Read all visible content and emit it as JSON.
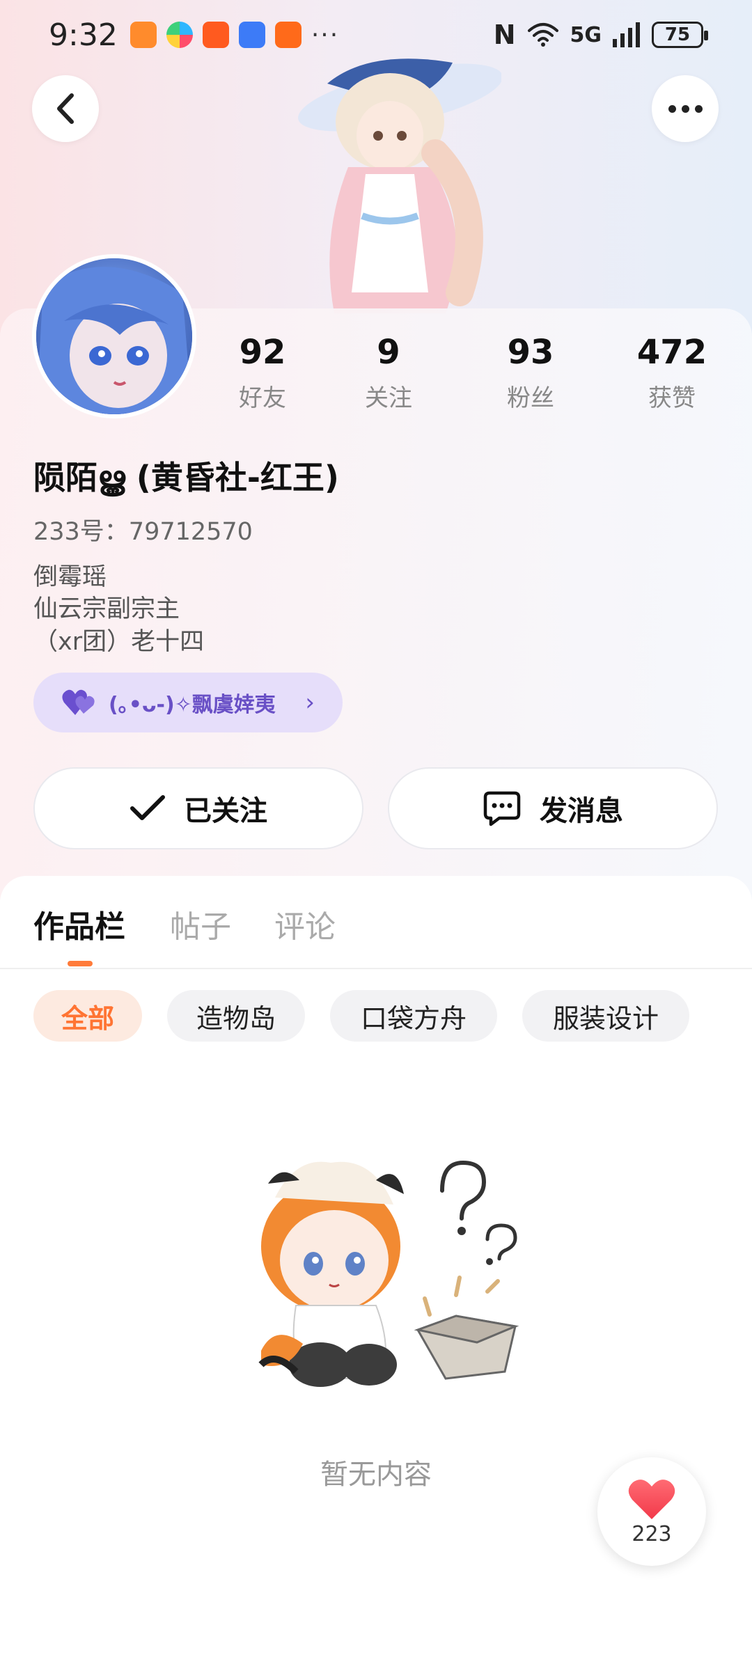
{
  "status_bar": {
    "time": "9:32",
    "more_indicator": "···",
    "nfc_label": "N",
    "network_label": "5G",
    "battery_level": "75"
  },
  "header": {
    "back_icon": "chevron-left-icon",
    "more_icon": "more-horizontal-icon"
  },
  "profile": {
    "stats": [
      {
        "value": "92",
        "label": "好友"
      },
      {
        "value": "9",
        "label": "关注"
      },
      {
        "value": "93",
        "label": "粉丝"
      },
      {
        "value": "472",
        "label": "获赞"
      }
    ],
    "username": "陨陌ൠ (黄昏社-红王)",
    "uid": "233号：79712570",
    "bio": [
      "倒霉瑶",
      "仙云宗副宗主",
      "（xr团）老十四"
    ],
    "badge_text": "(｡•ᴗ-)✧飘虞婞夷",
    "badge_chevron": "›"
  },
  "actions": {
    "follow_label": "已关注",
    "message_label": "发消息"
  },
  "tabs": [
    {
      "label": "作品栏",
      "active": true
    },
    {
      "label": "帖子",
      "active": false
    },
    {
      "label": "评论",
      "active": false
    }
  ],
  "filters": [
    {
      "label": "全部",
      "active": true
    },
    {
      "label": "造物岛",
      "active": false
    },
    {
      "label": "口袋方舟",
      "active": false
    },
    {
      "label": "服装设计",
      "active": false
    }
  ],
  "empty_state": {
    "text": "暂无内容"
  },
  "like_button": {
    "count": "223"
  },
  "colors": {
    "accent": "#ff7433",
    "badge_bg": "#e6defa",
    "badge_text": "#6950c6",
    "heart": "#f2394a"
  }
}
